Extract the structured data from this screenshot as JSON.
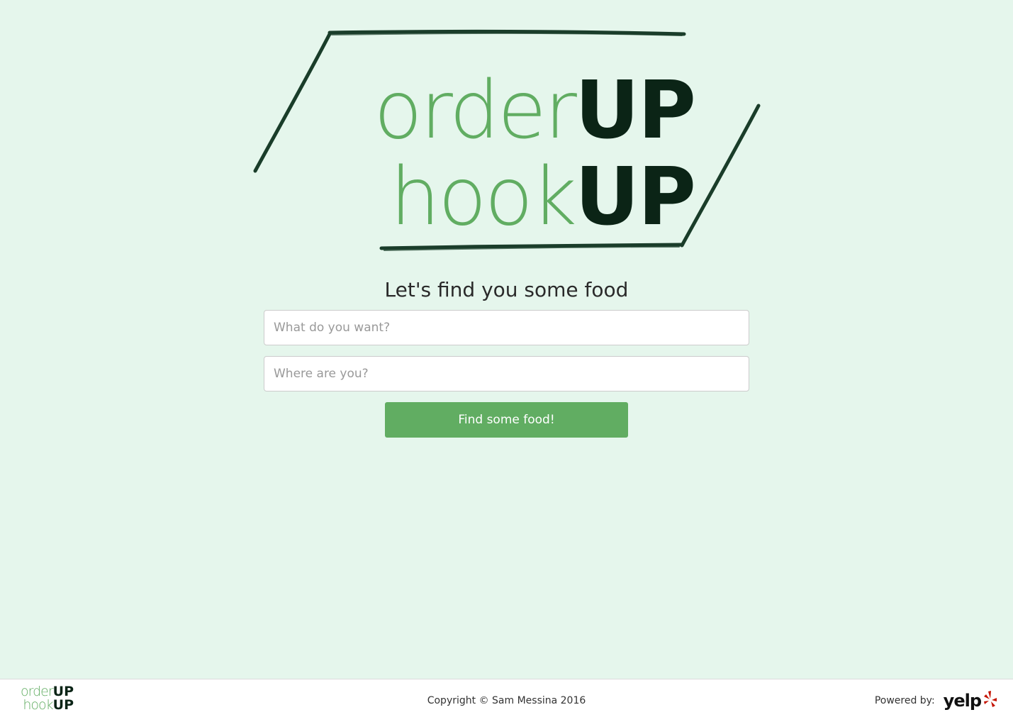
{
  "hero_logo": {
    "line1_light": "order",
    "line1_bold": "UP",
    "line2_light": "hook",
    "line2_bold": "UP"
  },
  "search": {
    "heading": "Let's find you some food",
    "what_placeholder": "What do you want?",
    "what_value": "",
    "where_placeholder": "Where are you?",
    "where_value": "",
    "submit_label": "Find some food!"
  },
  "footer": {
    "logo_line1_light": "order",
    "logo_line1_bold": "UP",
    "logo_line2_light": "hook",
    "logo_line2_bold": "UP",
    "copyright": "Copyright © Sam Messina 2016",
    "powered_by": "Powered by:",
    "yelp_text": "yelp"
  },
  "colors": {
    "background": "#e5f6ec",
    "accent_green": "#61ad62",
    "dark_green": "#0b2416",
    "yelp_red": "#c41200"
  },
  "icons": {
    "logo_frame": "chalk-parallelogram-frame",
    "yelp_logo": "yelp-burst-icon"
  }
}
